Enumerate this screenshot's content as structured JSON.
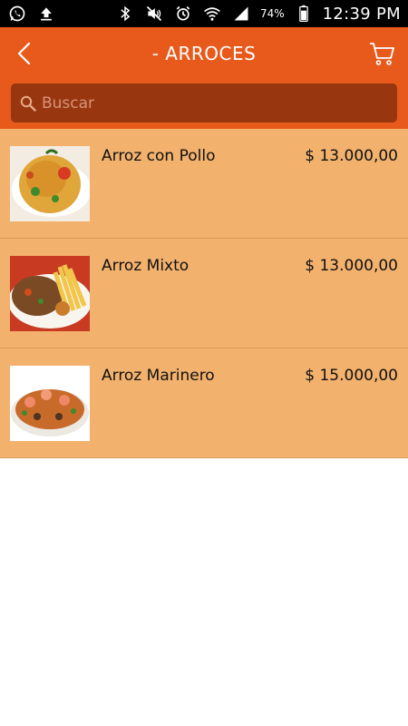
{
  "status_bar": {
    "left_icons": [
      "whatsapp-icon",
      "upload-icon"
    ],
    "right_icons": [
      "bluetooth-icon",
      "mute-icon",
      "alarm-icon",
      "wifi-icon",
      "signal-icon",
      "battery-icon"
    ],
    "battery": "74%",
    "time": "12:39 PM"
  },
  "header": {
    "title": "- ARROCES",
    "back_icon": "chevron-left-icon",
    "cart_icon": "cart-icon",
    "background_color": "#E8591C"
  },
  "search": {
    "placeholder": "Buscar",
    "value": "",
    "icon": "search-icon"
  },
  "items": [
    {
      "name": "Arroz con Pollo",
      "price": "$ 13.000,00"
    },
    {
      "name": "Arroz Mixto",
      "price": "$ 13.000,00"
    },
    {
      "name": "Arroz Marinero",
      "price": "$ 15.000,00"
    }
  ],
  "colors": {
    "list_background": "#F2B16D",
    "search_background": "#98370F"
  }
}
